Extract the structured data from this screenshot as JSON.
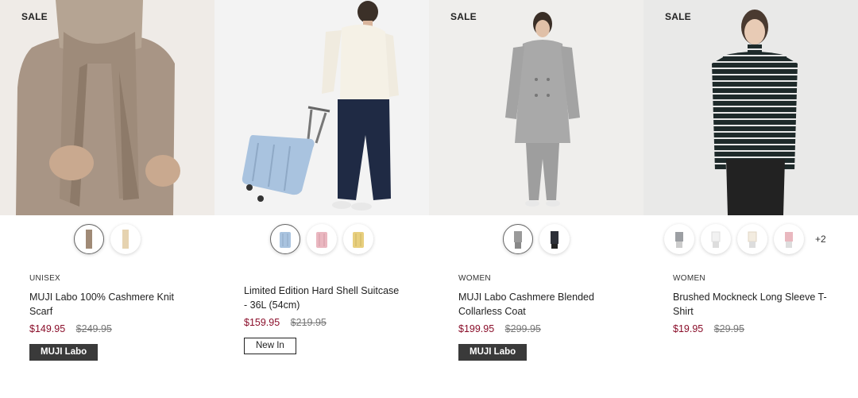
{
  "products": [
    {
      "badge": "SALE",
      "category": "UNISEX",
      "name": "MUJI Labo 100% Cashmere Knit Scarf",
      "price": "$149.95",
      "original_price": "$249.95",
      "tag": "MUJI Labo",
      "swatches": [
        "#a08a76",
        "#e6d3b0"
      ]
    },
    {
      "badge": "",
      "category": "",
      "name": "Limited Edition Hard Shell Suitcase - 36L (54cm)",
      "price": "$159.95",
      "original_price": "$219.95",
      "tag": "New In",
      "swatches": [
        "#a9c3df",
        "#eab7c0",
        "#e8cf7e"
      ]
    },
    {
      "badge": "SALE",
      "category": "WOMEN",
      "name": "MUJI Labo Cashmere Blended Collarless Coat",
      "price": "$199.95",
      "original_price": "$299.95",
      "tag": "MUJI Labo",
      "swatches": [
        "#9a9a9a",
        "#2d3038"
      ]
    },
    {
      "badge": "SALE",
      "category": "WOMEN",
      "name": "Brushed Mockneck Long Sleeve T-Shirt",
      "price": "$19.95",
      "original_price": "$29.95",
      "tag": "",
      "swatches": [
        "#9c9fa3",
        "#f2f2f2",
        "#f3ece0",
        "#e9b8bf"
      ],
      "more_colors": "+2"
    }
  ]
}
